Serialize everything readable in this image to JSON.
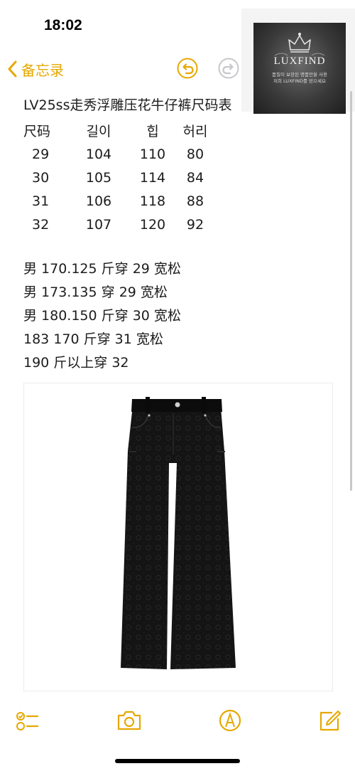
{
  "status_bar": {
    "time": "18:02"
  },
  "nav": {
    "back_label": "备忘录"
  },
  "watermark": {
    "brand": "LUXFIND",
    "sub_line1": "품질이 보장된 명품만을 사용",
    "sub_line2": "저희 LUXFIND를 믿으세요"
  },
  "note": {
    "title": "LV25ss走秀浮雕压花牛仔裤尺码表",
    "size_table": {
      "headers": [
        "尺码",
        "길이",
        "힙",
        "허리"
      ],
      "rows": [
        [
          "29",
          "104",
          "110",
          "80"
        ],
        [
          "30",
          "105",
          "114",
          "84"
        ],
        [
          "31",
          "106",
          "118",
          "88"
        ],
        [
          "32",
          "107",
          "120",
          "92"
        ]
      ]
    },
    "fit_lines": [
      "男 170.125 斤穿 29 宽松",
      "男 173.135 穿 29 宽松",
      "男 180.150 斤穿 30 宽松",
      "183 170 斤穿 31 宽松",
      "190 斤以上穿 32"
    ]
  },
  "colors": {
    "accent": "#e6a800",
    "text": "#1c1c1e"
  },
  "icons": [
    "chevron-left-icon",
    "undo-icon",
    "redo-icon",
    "checklist-icon",
    "camera-icon",
    "markup-pen-icon",
    "compose-icon"
  ]
}
